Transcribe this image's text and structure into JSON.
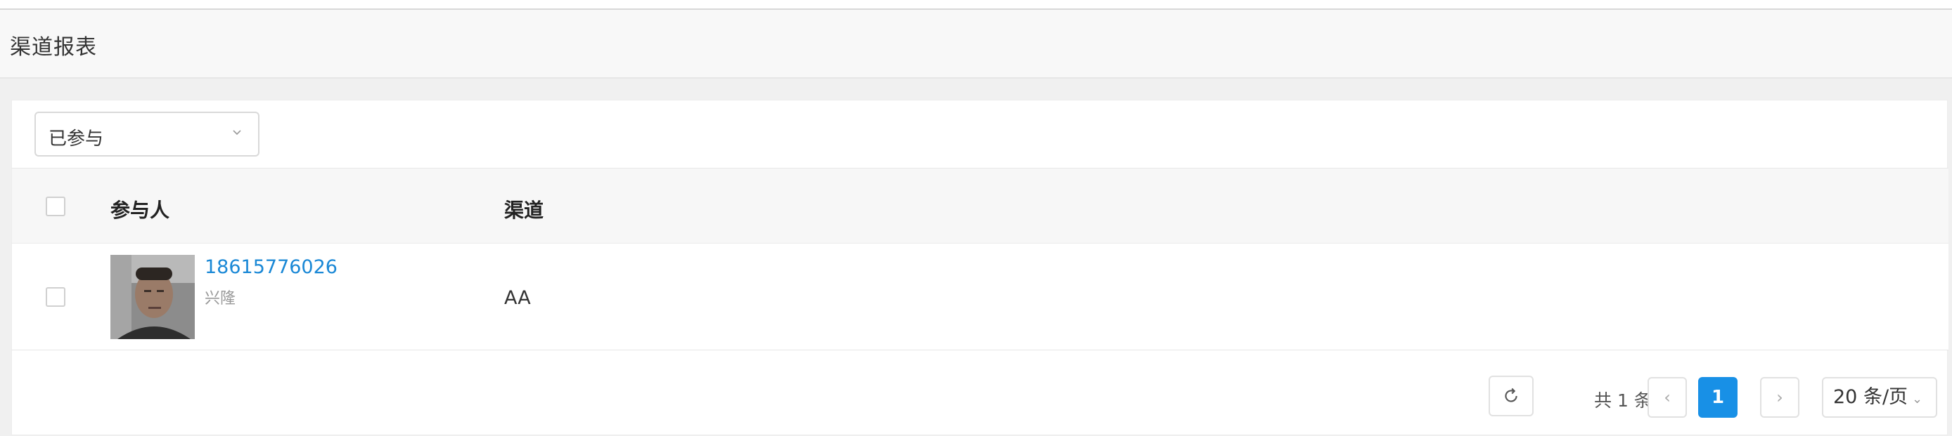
{
  "page": {
    "title": "渠道报表"
  },
  "filter": {
    "selected": "已参与",
    "icon": "chevron-down-icon"
  },
  "table": {
    "columns": [
      "参与人",
      "渠道"
    ],
    "rows": [
      {
        "phone": "18615776026",
        "name": "兴隆",
        "channel": "AA"
      }
    ]
  },
  "pagination": {
    "total_text": "共 1 条",
    "prev": "‹",
    "next": "›",
    "current_page": "1",
    "page_size": "20 条/页",
    "refresh_icon": "refresh-icon"
  }
}
